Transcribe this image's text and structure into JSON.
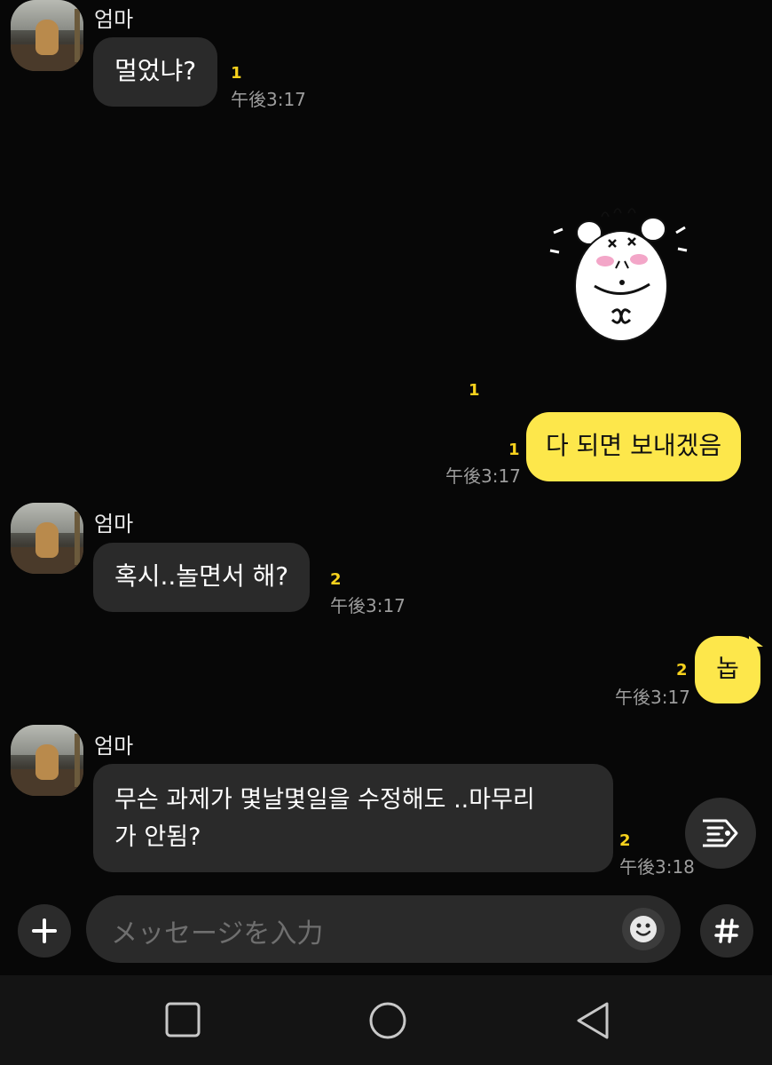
{
  "chat": {
    "messages": [
      {
        "sender": "엄마",
        "text": "멀었냐?",
        "unread": "1",
        "time": "午後3:17"
      },
      {
        "sticker_unread": "1"
      },
      {
        "text": "다 되면 보내겠음",
        "unread": "1",
        "time": "午後3:17"
      },
      {
        "sender": "엄마",
        "text": "혹시..놀면서 해?",
        "unread": "2",
        "time": "午後3:17"
      },
      {
        "text": "놉",
        "unread": "2",
        "time": "午後3:17"
      },
      {
        "sender": "엄마",
        "text_line1": "무슨 과제가 몇날몇일을 수정해도 ..마무리",
        "text_line2": "가 안됨?",
        "unread": "2",
        "time": "午後3:18"
      }
    ]
  },
  "input": {
    "placeholder": "メッセージを入力"
  },
  "icons": {
    "plus": "plus-icon",
    "emoji": "emoji-smile-icon",
    "hashtag": "hashtag-icon",
    "scroll_menu": "chat-summary-icon",
    "nav_recents": "square-icon",
    "nav_home": "circle-icon",
    "nav_back": "triangle-back-icon"
  },
  "colors": {
    "background": "#070707",
    "incoming_bubble": "#2a2a2a",
    "outgoing_bubble": "#fde74b",
    "unread_count": "#f7d21d"
  }
}
